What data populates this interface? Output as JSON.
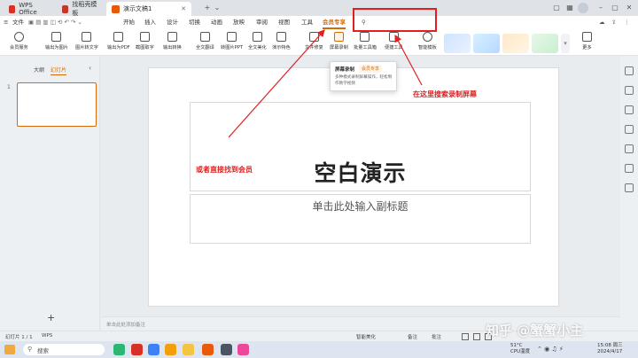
{
  "tabs": [
    {
      "label": "WPS Office"
    },
    {
      "label": "找稻壳模板"
    },
    {
      "label": "演示文稿1"
    }
  ],
  "menu": {
    "file": "文件",
    "items": [
      "开始",
      "插入",
      "设计",
      "切换",
      "动画",
      "放映",
      "审阅",
      "视图",
      "工具",
      "会员专享"
    ],
    "active": "会员专享"
  },
  "ribbon": {
    "buttons": [
      "会员服务",
      "输出为图片",
      "图片转文字",
      "输出为PDF",
      "截图取字",
      "输出转换",
      "全文翻译",
      "转图片PPT",
      "全文美化",
      "演示特色",
      "文件修复",
      "屏幕录制",
      "批量工具箱",
      "便捷工具",
      "智能模板",
      "更多"
    ]
  },
  "left_panel": {
    "tab_outline": "大纲",
    "tab_slides": "幻灯片",
    "slide_number": "1",
    "add_label": "+"
  },
  "slide": {
    "title": "空白演示",
    "subtitle": "单击此处输入副标题"
  },
  "notes_placeholder": "单击此处添加备注",
  "dropdown": {
    "title": "屏幕录制",
    "badge": "会员专享",
    "desc": "多种模式录制屏幕操作，轻松制作教学视频"
  },
  "annotations": {
    "search_hint": "在这里搜索录制屏幕",
    "member_hint": "或者直接找到会员"
  },
  "status": {
    "slide_counter": "幻灯片 1 / 1",
    "app": "WPS",
    "smart_beautify": "智能美化",
    "notes": "备注",
    "comments": "批注"
  },
  "taskbar": {
    "search_placeholder": "搜索",
    "weather_temp": "51°C",
    "weather_desc": "CPU温度",
    "time": "15:08 周三",
    "date": "2024/4/17"
  },
  "watermark": "知乎 @蟹蟹小主",
  "colors": {
    "accent": "#d46b08",
    "annotation": "#e02020",
    "tab_wps": "#d93025",
    "tab_templ": "#c0392b",
    "tab_ppt": "#e8590c"
  }
}
